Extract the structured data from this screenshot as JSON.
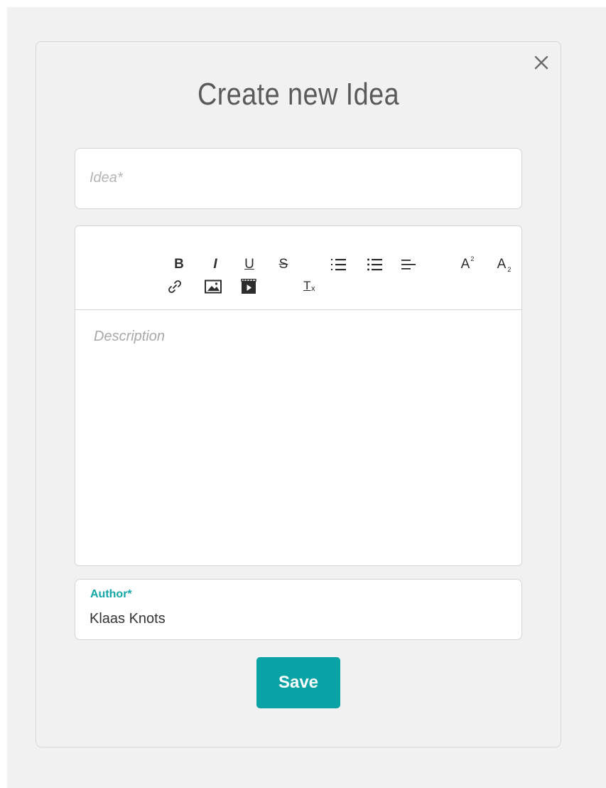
{
  "modal": {
    "title": "Create new Idea"
  },
  "idea_field": {
    "placeholder": "Idea*",
    "value": ""
  },
  "editor": {
    "toolbar": {
      "bold": "B",
      "italic": "I",
      "underline": "U",
      "strike": "S",
      "superscript": "A",
      "subscript": "A",
      "clean": "T"
    },
    "placeholder": "Description",
    "value": ""
  },
  "author_field": {
    "label": "Author*",
    "value": "Klaas Knots"
  },
  "save_button": {
    "label": "Save"
  },
  "colors": {
    "accent": "#0aa3a5",
    "background": "#f1f1f1"
  },
  "icons": [
    "close-icon",
    "bold-icon",
    "italic-icon",
    "underline-icon",
    "strikethrough-icon",
    "ordered-list-icon",
    "bullet-list-icon",
    "align-icon",
    "superscript-icon",
    "subscript-icon",
    "link-icon",
    "image-icon",
    "video-icon",
    "clear-format-icon"
  ]
}
